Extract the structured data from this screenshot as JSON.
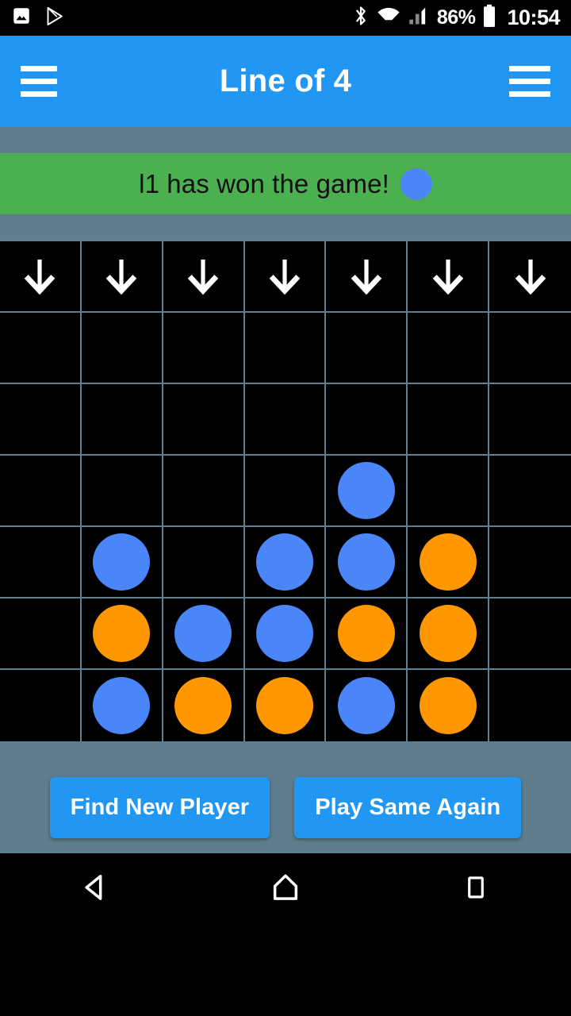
{
  "statusbar": {
    "icons_left": [
      "photo-icon",
      "play-store-icon"
    ],
    "icons_right": [
      "bluetooth-icon",
      "wifi-icon",
      "cellular-signal-icon"
    ],
    "battery_percent": "86%",
    "battery_icon": "battery-full-icon",
    "clock": "10:54"
  },
  "appbar": {
    "left_menu_icon": "hamburger-menu-icon",
    "title": "Line of 4",
    "right_menu_icon": "hamburger-menu-icon"
  },
  "banner": {
    "message": "l1 has won the game!",
    "winner_disc_color": "#4a86f7",
    "background_color": "#4caf50"
  },
  "board": {
    "columns": 7,
    "rows": 7,
    "drop_arrow_icon": "arrow-down-icon",
    "player1_color": "#4a86f7",
    "player2_color": "#ff9800",
    "grid_line_color": "#60808f",
    "cell_background": "#000000",
    "cells": [
      [
        "arrow",
        "arrow",
        "arrow",
        "arrow",
        "arrow",
        "arrow",
        "arrow"
      ],
      [
        "",
        "",
        "",
        "",
        "",
        "",
        ""
      ],
      [
        "",
        "",
        "",
        "",
        "",
        "",
        ""
      ],
      [
        "",
        "",
        "",
        "",
        "p1",
        "",
        ""
      ],
      [
        "",
        "p1",
        "",
        "p1",
        "p1",
        "p2",
        ""
      ],
      [
        "",
        "p2",
        "p1",
        "p1",
        "p2",
        "p2",
        ""
      ],
      [
        "",
        "p1",
        "p2",
        "p2",
        "p1",
        "p2",
        ""
      ]
    ]
  },
  "actions": {
    "find_new_player_label": "Find New Player",
    "play_same_again_label": "Play Same Again",
    "button_color": "#2196f3"
  },
  "navbar": {
    "back_icon": "back-triangle-icon",
    "home_icon": "home-icon",
    "recents_icon": "recents-square-icon"
  },
  "theme": {
    "page_background": "#5f7d8c",
    "appbar_color": "#2196f3"
  }
}
